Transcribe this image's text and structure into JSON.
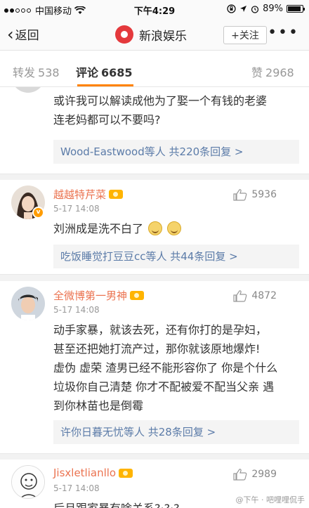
{
  "status_bar": {
    "carrier": "中国移动",
    "time": "下午4:29",
    "battery": "89%",
    "battery_level": 0.89,
    "signal_bars": 2
  },
  "nav": {
    "back_label": "返回",
    "title": "新浪娱乐",
    "follow_label": "+关注",
    "more_label": "•••"
  },
  "tabs": {
    "repost": {
      "label": "转发",
      "count": "538"
    },
    "comment": {
      "label": "评论",
      "count": "6685"
    },
    "like": {
      "label": "赞",
      "count": "2968"
    }
  },
  "comments": [
    {
      "text_line1": "或许我可以解读成他为了娶一个有钱的老婆",
      "text_line2": "连老妈都可以不要吗?",
      "reply_summary": "Wood-Eastwood等人  共220条回复 >"
    },
    {
      "username": "越越特芹菜",
      "time": "5-17 14:08",
      "likes": "5936",
      "text": "刘洲成是洗不白了",
      "reply_summary": "吃饭睡觉打豆豆cc等人  共44条回复 >",
      "verified": "v"
    },
    {
      "username": "全微博第一男神",
      "time": "5-17 14:08",
      "likes": "4872",
      "text_lines": [
        "动手家暴，就该去死，还有你打的是孕妇，",
        "甚至还把她打流产过，那你就该原地爆炸!",
        "虚伪 虚荣 渣男已经不能形容你了 你是个什么",
        "垃圾你自己清楚 你才不配被爱不配当父亲 遇",
        "到你林苗也是倒霉"
      ],
      "reply_summary": "许你日暮无忧等人  共28条回复 >"
    },
    {
      "username": "Jisxletlianllo",
      "time": "5-17 14:08",
      "likes": "2989",
      "text": "后月跟家暴有啥关系?·?·?"
    }
  ],
  "watermark": "@下午 · 吧哩哩侃手"
}
